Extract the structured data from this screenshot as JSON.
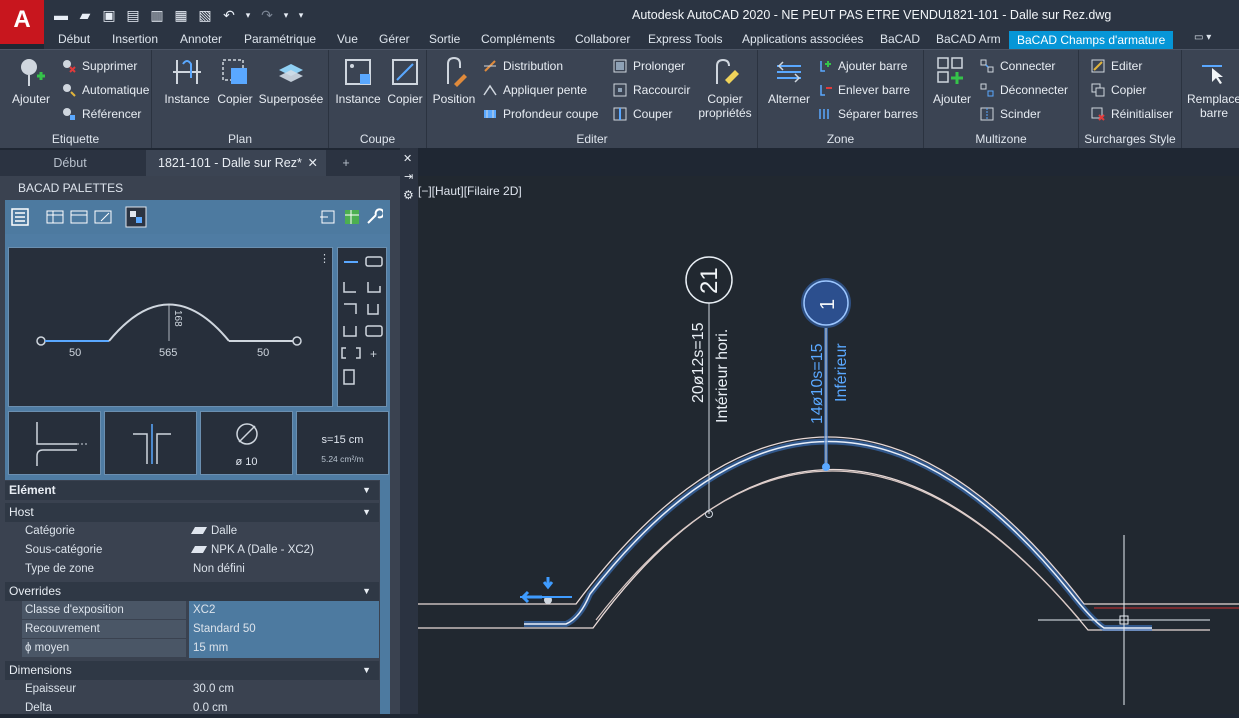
{
  "app": {
    "logo_letter": "A",
    "title": "Autodesk AutoCAD 2020 - NE PEUT PAS ETRE VENDU",
    "filename": "1821-101 - Dalle sur Rez.dwg"
  },
  "ribbon_tabs": [
    "Début",
    "Insertion",
    "Annoter",
    "Paramétrique",
    "Vue",
    "Gérer",
    "Sortie",
    "Compléments",
    "Collaborer",
    "Express Tools",
    "Applications associées",
    "BaCAD",
    "BaCAD Arm",
    "BaCAD Champs d'armature"
  ],
  "ribbon": {
    "etiquette": {
      "title": "Etiquette",
      "ajouter": "Ajouter",
      "supprimer": "Supprimer",
      "automatique": "Automatique",
      "referencer": "Référencer"
    },
    "plan": {
      "title": "Plan",
      "instance": "Instance",
      "copier": "Copier",
      "superposee": "Superposée"
    },
    "coupe": {
      "title": "Coupe",
      "instance": "Instance",
      "copier": "Copier"
    },
    "editer": {
      "title": "Editer",
      "position": "Position",
      "distribution": "Distribution",
      "appliquer_pente": "Appliquer pente",
      "profondeur_coupe": "Profondeur coupe",
      "prolonger": "Prolonger",
      "raccourcir": "Raccourcir",
      "couper": "Couper",
      "copier_proprietes_1": "Copier",
      "copier_proprietes_2": "propriétés"
    },
    "zone": {
      "title": "Zone",
      "alterner": "Alterner",
      "ajouter_barre": "Ajouter barre",
      "enlever_barre": "Enlever barre",
      "separer_barres": "Séparer barres"
    },
    "multizone": {
      "title": "Multizone",
      "ajouter": "Ajouter",
      "connecter": "Connecter",
      "deconnecter": "Déconnecter",
      "scinder": "Scinder"
    },
    "surcharges": {
      "title": "Surcharges Style",
      "editer": "Editer",
      "copier": "Copier",
      "reinitialiser": "Réinitialiser"
    },
    "remplacer": {
      "line1": "Remplace",
      "line2": "barre"
    }
  },
  "doc_tabs": {
    "home": "Début",
    "file": "1821-101 - Dalle sur Rez*",
    "add": "+"
  },
  "palette": {
    "title": "BACAD PALETTES",
    "shape": {
      "dim_left": "50",
      "dim_mid": "565",
      "dim_right": "50",
      "dim_height": "168"
    },
    "thumb_diameter": "ø 10",
    "thumb_spacing": "s=15 cm",
    "thumb_area": "5.24 cm²/m",
    "sections": {
      "element": "Elément",
      "host": "Host",
      "overrides": "Overrides",
      "dimensions": "Dimensions"
    },
    "host_rows": [
      {
        "k": "Catégorie",
        "v": "Dalle"
      },
      {
        "k": "Sous-catégorie",
        "v": "NPK A (Dalle - XC2)"
      },
      {
        "k": "Type de zone",
        "v": "Non défini"
      }
    ],
    "override_rows": [
      {
        "k": "Classe d'exposition",
        "v": "XC2"
      },
      {
        "k": "Recouvrement",
        "v": "Standard 50"
      },
      {
        "k": "ϕ moyen",
        "v": "15 mm"
      }
    ],
    "dimension_rows": [
      {
        "k": "Epaisseur",
        "v": "30.0 cm"
      },
      {
        "k": "Delta",
        "v": "0.0 cm"
      }
    ]
  },
  "viewport": {
    "label": "[−][Haut][Filaire 2D]",
    "tag1_number": "21",
    "tag1_text1": "20ø12s=15",
    "tag1_text2": "Intérieur hori.",
    "tag2_number": "1",
    "tag2_text1": "14ø10s=15",
    "tag2_text2": "Inférieur"
  },
  "colors": {
    "accent": "#0696d7",
    "rebar_selected": "#5aa8ff",
    "logo": "#c8161e"
  }
}
